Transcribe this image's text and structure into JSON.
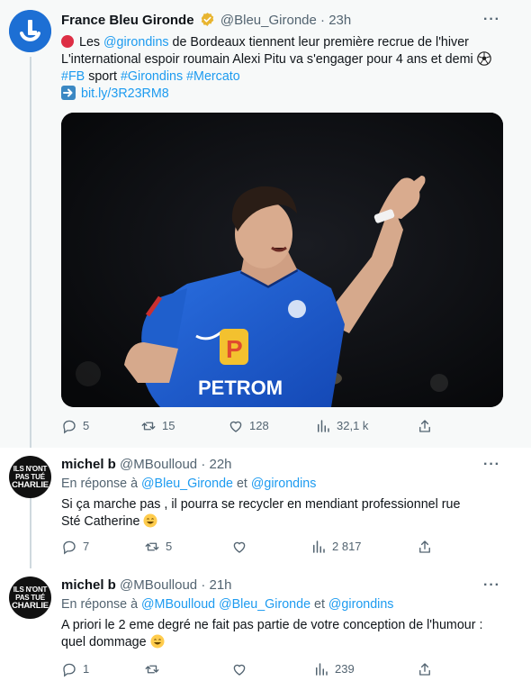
{
  "main": {
    "name": "France Bleu Gironde",
    "handle": "@Bleu_Gironde",
    "dot": "·",
    "time": "23h",
    "more": "···",
    "line1_pre": "Les ",
    "line1_mention": "@girondins",
    "line1_post": " de Bordeaux tiennent leur première recrue de l'hiver",
    "line2": "L'international espoir roumain Alexi Pitu va s'engager pour 4 ans et demi",
    "tag1": "#FB",
    "word_sport": " sport ",
    "tag2": "#Girondins",
    "tag3": "#Mercato",
    "url": "bit.ly/3R23RM8",
    "jersey_text": "PETROM",
    "actions": {
      "reply": "5",
      "retweet": "15",
      "like": "128",
      "views": "32,1 k"
    },
    "icons": [
      "red-circle",
      "soccer-ball",
      "right-arrow-box",
      "verified-badge"
    ]
  },
  "reply1": {
    "name": "michel b",
    "handle": "@MBoulloud",
    "dot": "·",
    "time": "22h",
    "more": "···",
    "replying_prefix": "En réponse à ",
    "replying_m1": "@Bleu_Gironde",
    "replying_and": " et ",
    "replying_m2": "@girondins",
    "line1": "Si ça marche pas , il pourra se recycler en mendiant professionnel rue",
    "line2": "Sté  Catherine",
    "actions": {
      "reply": "7",
      "retweet": "5",
      "like": "",
      "views": "2 817"
    }
  },
  "reply2": {
    "name": "michel b",
    "handle": "@MBoulloud",
    "dot": "·",
    "time": "21h",
    "more": "···",
    "replying_prefix": "En réponse à ",
    "replying_m1": "@MBoulloud",
    "replying_m2": "@Bleu_Gironde",
    "replying_and": " et ",
    "replying_m3": "@girondins",
    "line1": "A priori le 2 eme degré ne fait pas partie de votre conception de l'humour :",
    "line2": "quel dommage",
    "actions": {
      "reply": "1",
      "retweet": "",
      "like": "",
      "views": "239"
    }
  },
  "avatar_text": {
    "l1": "ILS N'ONT",
    "l2": "PAS TUÉ",
    "l3": "CHARLIE"
  },
  "colors": {
    "link": "#1d9bf0",
    "muted": "#536471",
    "brand": "#1d6fd4",
    "jersey": "#1f5fcc"
  }
}
